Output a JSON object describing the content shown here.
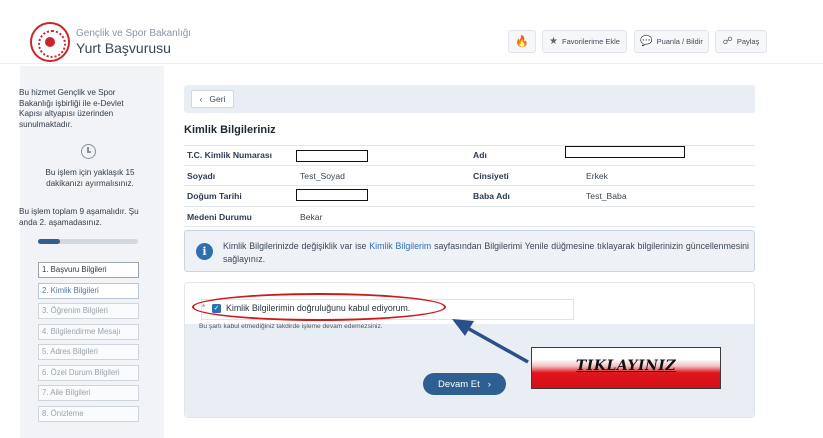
{
  "header": {
    "ministry": "Gençlik ve Spor Bakanlığı",
    "service": "Yurt Başvurusu",
    "buttons": {
      "favorites": "Favorilerime Ekle",
      "rate": "Puanla / Bildir",
      "share": "Paylaş"
    }
  },
  "sidebar": {
    "info": "Bu hizmet Gençlik ve Spor Bakanlığı işbirliği ile e-Devlet Kapısı altyapısı üzerinden sunulmaktadır.",
    "time": "Bu işlem için yaklaşık 15 dakikanızı ayırmalısınız.",
    "steps_total_text": "Bu işlem toplam 9 aşamalıdır. Şu anda 2. aşamadasınız.",
    "progress": 0.22,
    "steps": [
      "1. Başvuru Bilgileri",
      "2. Kimlik Bilgileri",
      "3. Öğrenim Bilgileri",
      "4. Bilgilendirme Mesajı",
      "5. Adres Bilgileri",
      "6. Özel Durum Bilgileri",
      "7. Aile Bilgileri",
      "8. Önizleme"
    ]
  },
  "main": {
    "back_label": "Geri",
    "section_title": "Kimlik Bilgileriniz",
    "fields": {
      "tc_label": "T.C. Kimlik Numarası",
      "ad_label": "Adı",
      "soyad_label": "Soyadı",
      "soyad_value": "Test_Soyad",
      "cinsiyet_label": "Cinsiyeti",
      "cinsiyet_value": "Erkek",
      "dogum_label": "Doğum Tarihi",
      "baba_label": "Baba Adı",
      "baba_value": "Test_Baba",
      "medeni_label": "Medeni Durumu",
      "medeni_value": "Bekar"
    },
    "info": {
      "part1": "Kimlik Bilgilerinizde değişiklik var ise ",
      "link": "Kimlik Bilgilerim",
      "part2": " sayfasından Bilgilerimi Yenile düğmesine tıklayarak bilgilerinizin güncellenmesini sağlayınız."
    },
    "consent": {
      "required_mark": "*",
      "label": "Kimlik Bilgilerimin doğruluğunu kabul ediyorum.",
      "checked": true,
      "note": "Bu şartı kabul etmediğiniz takdirde işleme devam edemezsiniz."
    },
    "continue_label": "Devam Et"
  },
  "annotation": {
    "callout": "TIKLAYINIZ",
    "ellipse_color": "#cc1b1b",
    "arrow_color": "#2b4f8a"
  }
}
